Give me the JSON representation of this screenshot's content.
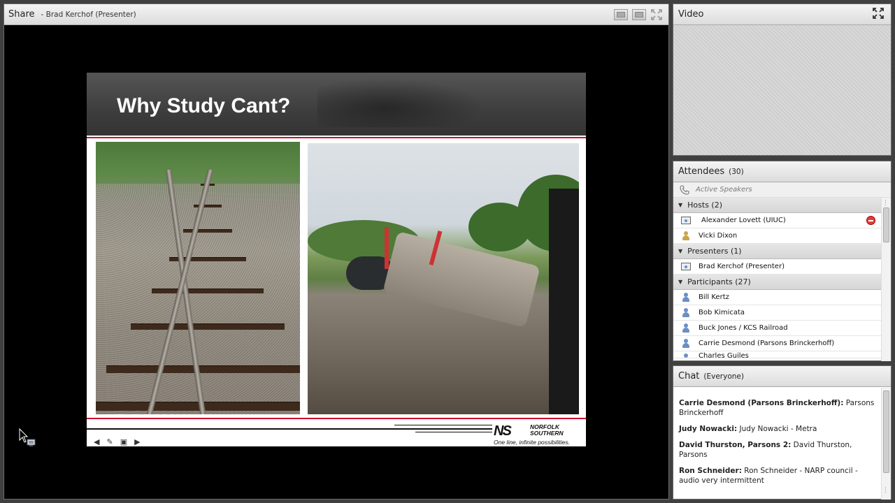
{
  "share": {
    "title": "Share",
    "presenter_label": "- Brad Kerchof (Presenter)"
  },
  "slide": {
    "title": "Why Study Cant?",
    "logo_mark": "NS",
    "logo_name": "NORFOLK SOUTHERN",
    "logo_tagline": "One line, infinite possibilities.",
    "accent_color": "#c8102e"
  },
  "video": {
    "title": "Video"
  },
  "attendees": {
    "title": "Attendees",
    "count": "(30)",
    "active_speakers": "Active Speakers",
    "hosts_header": "Hosts (2)",
    "hosts": [
      {
        "name": "Alexander Lovett (UIUC)"
      },
      {
        "name": "Vicki Dixon"
      }
    ],
    "presenters_header": "Presenters (1)",
    "presenters": [
      {
        "name": "Brad Kerchof (Presenter)"
      }
    ],
    "participants_header": "Participants (27)",
    "participants": [
      {
        "name": "Bill Kertz"
      },
      {
        "name": "Bob Kimicata"
      },
      {
        "name": "Buck Jones / KCS Railroad"
      },
      {
        "name": "Carrie Desmond (Parsons Brinckerhoff)"
      },
      {
        "name": "Charles Guiles"
      }
    ]
  },
  "chat": {
    "title": "Chat",
    "scope": "(Everyone)",
    "messages": [
      {
        "sender": "Carrie Desmond (Parsons Brinckerhoff):",
        "text": " Parsons Brinckerhoff"
      },
      {
        "sender": "Judy Nowacki:",
        "text": " Judy Nowacki - Metra"
      },
      {
        "sender": "David Thurston, Parsons 2:",
        "text": " David Thurston, Parsons"
      },
      {
        "sender": "Ron Schneider:",
        "text": " Ron Schneider - NARP council - audio very intermittent"
      }
    ]
  }
}
